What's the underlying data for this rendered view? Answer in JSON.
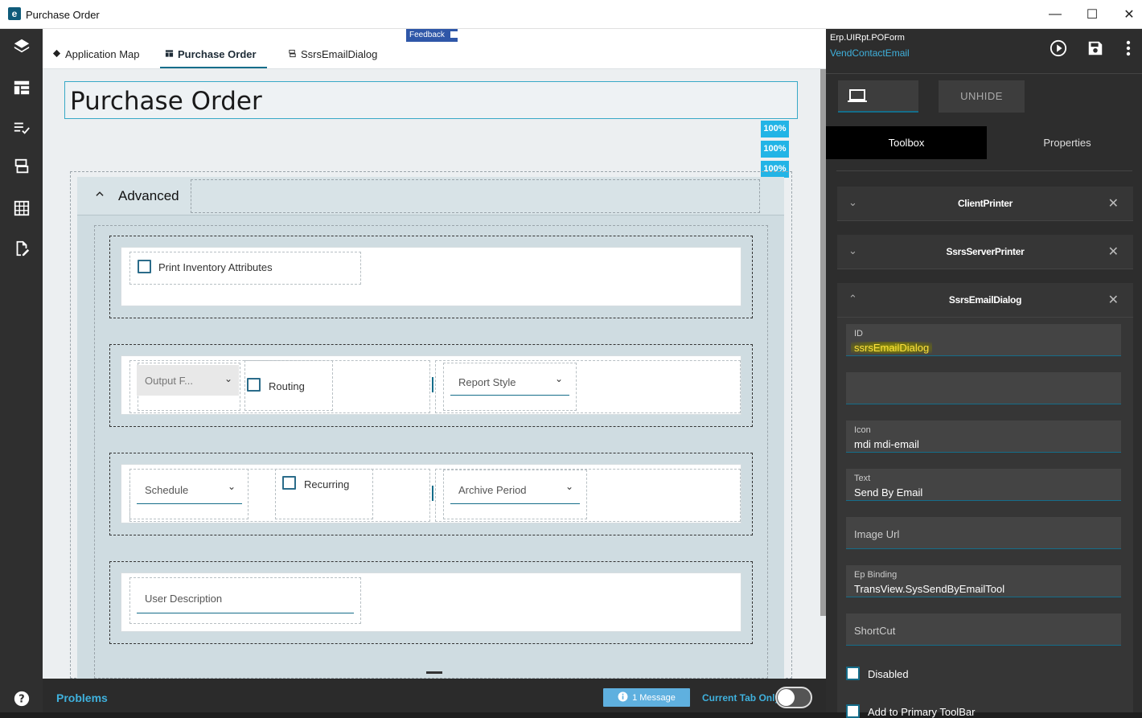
{
  "window": {
    "title": "Purchase Order",
    "controls": {
      "minimize": "—",
      "maximize": "☐",
      "close": "✕"
    }
  },
  "tabs": [
    {
      "label": "Application Map",
      "icon": "map-icon"
    },
    {
      "label": "Purchase Order",
      "icon": "form-icon",
      "active": true
    },
    {
      "label": "SsrsEmailDialog",
      "icon": "dialog-icon"
    }
  ],
  "feedback": {
    "label": "Feedback"
  },
  "page": {
    "title": "Purchase Order",
    "percent_badges": [
      "100%",
      "100%",
      "100%"
    ]
  },
  "advanced": {
    "label": "Advanced",
    "chevron": "⌃",
    "print_inventory": "Print Inventory Attributes",
    "output_format": "Output F...",
    "routing": "Routing",
    "report_style": "Report Style",
    "schedule": "Schedule",
    "recurring": "Recurring",
    "archive_period": "Archive Period",
    "user_description": "User Description"
  },
  "bottom": {
    "problems": "Problems",
    "message": "1 Message",
    "current_tab_only": "Current Tab Only"
  },
  "right_panel": {
    "form_name": "Erp.UIRpt.POForm",
    "sub_name": "VendContactEmail",
    "unhide": "UNHIDE",
    "tabs": {
      "toolbox": "Toolbox",
      "properties": "Properties"
    },
    "accordions": [
      "ClientPrinter",
      "SsrsServerPrinter",
      "SsrsEmailDialog"
    ],
    "fields": {
      "id_label": "ID",
      "id_value": "ssrsEmailDialog",
      "blank_value": "",
      "icon_label": "Icon",
      "icon_value": "mdi mdi-email",
      "text_label": "Text",
      "text_value": "Send By Email",
      "image_url_placeholder": "Image Url",
      "ep_binding_label": "Ep Binding",
      "ep_binding_value": "TransView.SysSendByEmailTool",
      "shortcut_placeholder": "ShortCut"
    },
    "disabled": "Disabled",
    "add_primary": "Add to Primary ToolBar"
  },
  "colors": {
    "accent": "#156d8a",
    "badge": "#22b4e6",
    "highlight": "#ffe13d"
  }
}
